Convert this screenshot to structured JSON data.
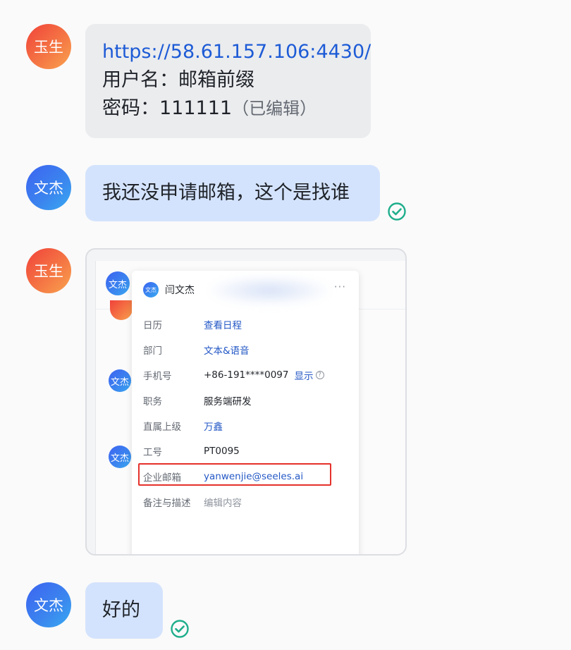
{
  "messages": [
    {
      "sender": "玉生",
      "lines": {
        "url": "https://58.61.157.106:4430/",
        "username": "用户名：邮箱前缀",
        "password": "密码：111111",
        "edited": "（已编辑）"
      }
    },
    {
      "sender": "文杰",
      "text": "我还没申请邮箱，这个是找谁"
    },
    {
      "sender": "玉生",
      "screenshot": {
        "avatar_labels": [
          "文杰",
          "文杰",
          "文杰"
        ],
        "profile": {
          "avatar_label": "文杰",
          "name": "闫文杰",
          "more": "···",
          "fields": [
            {
              "key": "日历",
              "value": "查看日程"
            },
            {
              "key": "部门",
              "value": "文本&语音"
            },
            {
              "key": "手机号",
              "value": "+86-191****0097",
              "action": "显示",
              "help": "?"
            },
            {
              "key": "职务",
              "value": "服务端研发"
            },
            {
              "key": "直属上级",
              "value": "万鑫"
            },
            {
              "key": "工号",
              "value": "PT0095"
            },
            {
              "key": "企业邮箱",
              "value": "yanwenjie@seeles.ai"
            },
            {
              "key": "备注与描述",
              "value": "编辑内容"
            }
          ]
        }
      }
    },
    {
      "sender": "文杰",
      "text": "好的"
    }
  ],
  "colors": {
    "accent_link": "#1d5bd6",
    "read_check": "#1fae8c",
    "highlight_box": "#e5312b"
  }
}
